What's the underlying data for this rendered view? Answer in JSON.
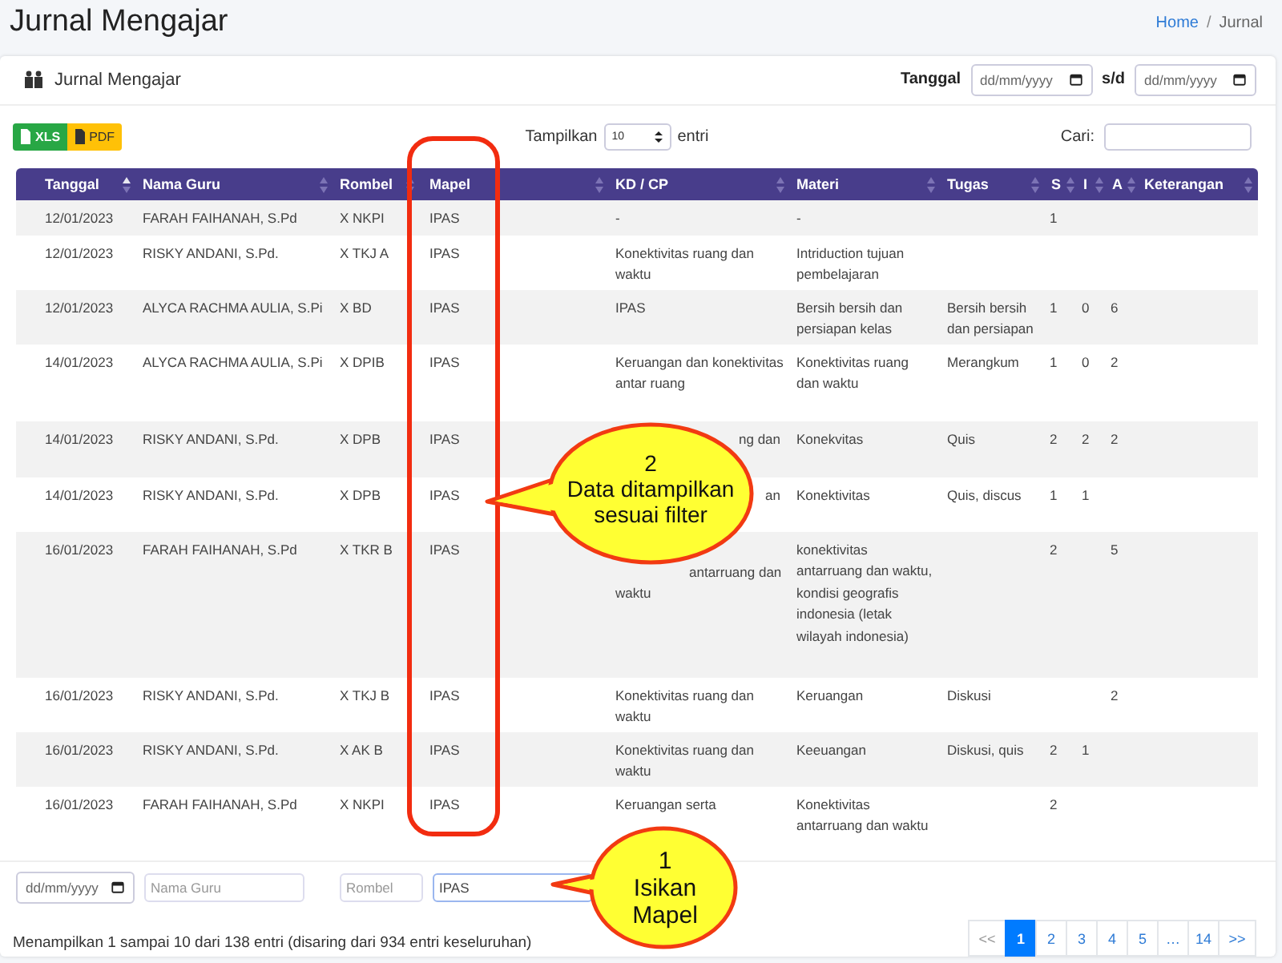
{
  "page": {
    "title": "Jurnal Mengajar",
    "breadcrumb": [
      {
        "label": "Home",
        "selected": false
      },
      {
        "label": "Jurnal",
        "selected": true
      }
    ],
    "breadcrumb_separator": "/"
  },
  "card": {
    "title": "Jurnal Mengajar",
    "date_label": "Tanggal",
    "date_from": {
      "placeholder": "dd/mm/yyyy"
    },
    "separator": "s/d",
    "date_to": {
      "placeholder": "dd/mm/yyyy"
    }
  },
  "export_buttons": [
    {
      "label": "XLS",
      "kind": "xls"
    },
    {
      "label": "PDF",
      "kind": "pdf"
    }
  ],
  "length": {
    "before": "Tampilkan",
    "value": "10",
    "after": "entri"
  },
  "search": {
    "label": "Cari:"
  },
  "table": {
    "columns": [
      {
        "label": "Tanggal",
        "sorted": true
      },
      {
        "label": "Nama Guru",
        "sorted": false
      },
      {
        "label": "Rombel",
        "sorted": false
      },
      {
        "label": "Mapel",
        "sorted": false
      },
      {
        "label": "KD / CP",
        "sorted": false
      },
      {
        "label": "Materi",
        "sorted": false
      },
      {
        "label": "Tugas",
        "sorted": false
      },
      {
        "label": "S",
        "sorted": false
      },
      {
        "label": "I",
        "sorted": false
      },
      {
        "label": "A",
        "sorted": false
      },
      {
        "label": "Keterangan",
        "sorted": false
      }
    ],
    "rows": [
      [
        "12/01/2023",
        "FARAH FAIHANAH, S.Pd",
        "X NKPI",
        "IPAS",
        "-",
        "-",
        null,
        "1",
        null,
        null,
        null
      ],
      [
        "12/01/2023",
        "RISKY ANDANI, S.Pd.",
        "X TKJ A",
        "IPAS",
        "Konektivitas ruang dan waktu",
        "Intriduction tujuan pembelajaran",
        null,
        null,
        null,
        null,
        null
      ],
      [
        "12/01/2023",
        "ALYCA RACHMA AULIA, S.Pi",
        "X BD",
        "IPAS",
        "IPAS",
        "Bersih bersih dan persiapan kelas",
        "Bersih bersih dan persiapan",
        "1",
        "0",
        "6",
        null
      ],
      [
        "14/01/2023",
        "ALYCA RACHMA AULIA, S.Pi",
        "X DPIB",
        "IPAS",
        "Keruangan dan konektivitas antar ruang",
        "Konektivitas ruang dan waktu",
        "Merangkum",
        "1",
        "0",
        "2",
        null
      ],
      [
        "14/01/2023",
        "RISKY ANDANI, S.Pd.",
        "X DPB",
        "IPAS",
        "ng dan",
        "Konekvitas",
        "Quis",
        "2",
        "2",
        "2",
        null
      ],
      [
        "14/01/2023",
        "RISKY ANDANI, S.Pd.",
        "X DPB",
        "IPAS",
        "an",
        "Konektivitas",
        "Quis, discus",
        "1",
        "1",
        null,
        null
      ],
      [
        "16/01/2023",
        "FARAH FAIHANAH, S.Pd",
        "X TKR B",
        "IPAS",
        "antarruang dan waktu",
        "konektivitas antarruang dan waktu, kondisi geografis indonesia (letak wilayah indonesia)",
        null,
        "2",
        null,
        "5",
        null
      ],
      [
        "16/01/2023",
        "RISKY ANDANI, S.Pd.",
        "X TKJ B",
        "IPAS",
        "Konektivitas ruang dan waktu",
        "Keruangan",
        "Diskusi",
        null,
        null,
        "2",
        null
      ],
      [
        "16/01/2023",
        "RISKY ANDANI, S.Pd.",
        "X AK B",
        "IPAS",
        "Konektivitas ruang dan waktu",
        "Keeuangan",
        "Diskusi, quis",
        "2",
        "1",
        null,
        null
      ],
      [
        "16/01/2023",
        "FARAH FAIHANAH, S.Pd",
        "X NKPI",
        "IPAS",
        "Keruangan serta",
        "Konektivitas antarruang dan waktu",
        null,
        "2",
        null,
        null,
        null
      ]
    ]
  },
  "filters": [
    {
      "kind": "date",
      "placeholder": "dd/mm/yyyy",
      "focused": false
    },
    {
      "kind": "text",
      "placeholder": "Nama Guru",
      "focused": false
    },
    {
      "kind": "text",
      "placeholder": "Rombel",
      "focused": false
    },
    {
      "kind": "text",
      "value": "IPAS",
      "focused": true
    }
  ],
  "info": "Menampilkan 1 sampai 10 dari 138 entri (disaring dari 934 entri keseluruhan)",
  "pagination": [
    {
      "label": "<<",
      "selected": false
    },
    {
      "label": "1",
      "selected": true
    },
    {
      "label": "2",
      "selected": false
    },
    {
      "label": "3",
      "selected": false
    },
    {
      "label": "4",
      "selected": false
    },
    {
      "label": "5",
      "selected": false
    },
    {
      "label": "…",
      "selected": false
    },
    {
      "label": "14",
      "selected": false
    },
    {
      "label": ">>",
      "selected": false
    }
  ],
  "annotations": [
    {
      "lines": [
        "2",
        "Data ditampilkan",
        "sesuai filter"
      ]
    },
    {
      "lines": [
        "1",
        "Isikan",
        "Mapel"
      ]
    }
  ]
}
